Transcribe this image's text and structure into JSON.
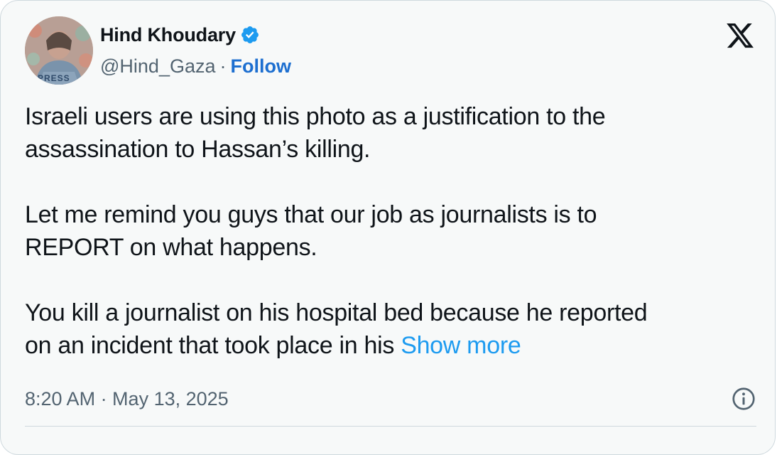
{
  "tweet": {
    "author": {
      "display_name": "Hind Khoudary",
      "handle": "@Hind_Gaza",
      "separator": "·",
      "follow_label": "Follow",
      "avatar_badge_text": "PRESS"
    },
    "text": {
      "paragraph_1": "Israeli users are using this photo as a justification to the\nassassination to Hassan’s killing.",
      "paragraph_2": "Let me remind you guys that our job as journalists is to\nREPORT on what happens.",
      "paragraph_3": "You kill a journalist on his hospital bed because he reported\non an incident that took place in his ",
      "show_more_label": "Show more"
    },
    "timestamp": "8:20 AM · May 13, 2025"
  },
  "icons": {
    "verified": "verified-badge-icon",
    "brand": "x-logo-icon",
    "info": "info-icon"
  },
  "colors": {
    "card_bg": "#f7f9f9",
    "text_primary": "#0f1419",
    "text_secondary": "#536471",
    "follow": "#1d6fd0",
    "link": "#1d9bf0",
    "verified": "#1d9bf0",
    "border": "#cfd9de"
  }
}
